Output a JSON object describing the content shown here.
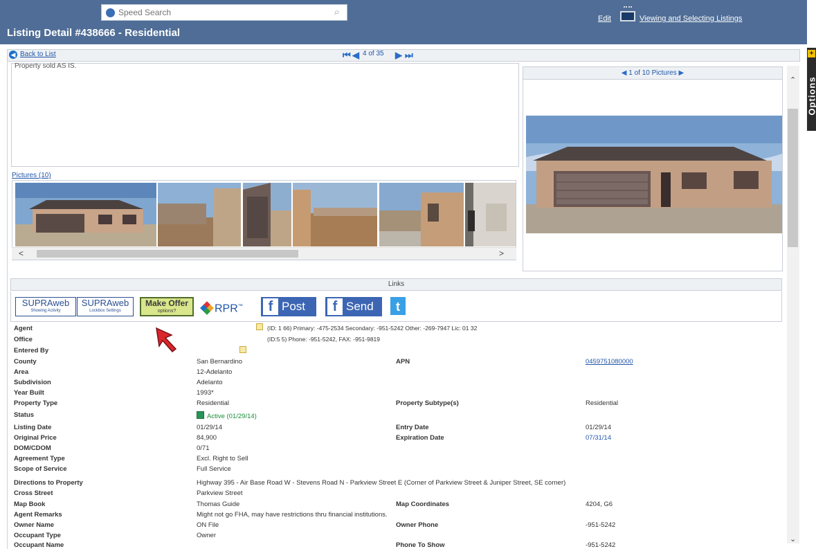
{
  "header": {
    "search_placeholder": "Speed Search",
    "title": "Listing Detail #438666 - Residential",
    "edit_label": "Edit",
    "viewing_label": "Viewing and Selecting Listings"
  },
  "nav": {
    "back_label": "Back to List",
    "pager": "4 of 35"
  },
  "options_label": "Options",
  "remarks_text": "Property sold AS IS.",
  "pictures_label": "Pictures (10)",
  "gallery_label": "1 of 10 Pictures",
  "links": {
    "title": "Links",
    "supra1": {
      "main": "SUPRAweb",
      "sub": "Showing Activity"
    },
    "supra2": {
      "main": "SUPRAweb",
      "sub": "Lockbox Settings"
    },
    "make_offer": {
      "main": "Make Offer",
      "sub": "options?"
    },
    "rpr": "RPR",
    "post": "Post",
    "send": "Send",
    "twitter": "t"
  },
  "details": [
    {
      "label": "Agent",
      "value": "(ID: 1   66) Primary:   -475-2534 Secondary:   -951-5242 Other:   -269-7947 Lic: 01   32"
    },
    {
      "label": "Office",
      "value": "(ID:5   5) Phone:   -951-5242, FAX:   -951-9819"
    },
    {
      "label": "Entered By",
      "value": ""
    },
    {
      "label": "County",
      "value": "San Bernardino",
      "label2": "APN",
      "value2": "0459751080000"
    },
    {
      "label": "Area",
      "value": "12-Adelanto"
    },
    {
      "label": "Subdivision",
      "value": "Adelanto"
    },
    {
      "label": "Year Built",
      "value": "1993*"
    },
    {
      "label": "Property Type",
      "value": "Residential",
      "label2": "Property Subtype(s)",
      "value2": "Residential"
    },
    {
      "label": "Status",
      "value": "Active",
      "value_date": "(01/29/14)"
    },
    {
      "label": "Listing Date",
      "value": "01/29/14",
      "label2": "Entry Date",
      "value2": "01/29/14"
    },
    {
      "label": "Original Price",
      "value": "84,900",
      "label2": "Expiration Date",
      "value2": "07/31/14"
    },
    {
      "label": "DOM/CDOM",
      "value": "0/71"
    },
    {
      "label": "Agreement Type",
      "value": "Excl. Right to Sell"
    },
    {
      "label": "Scope of Service",
      "value": "Full Service"
    },
    {
      "label": "Directions to Property",
      "value": "Highway 395 - Air Base Road W - Stevens Road N - Parkview Street E (Corner of Parkview Street & Juniper Street, SE corner)"
    },
    {
      "label": "Cross Street",
      "value": "Parkview Street"
    },
    {
      "label": "Map Book",
      "value": "Thomas Guide",
      "label2": "Map Coordinates",
      "value2": "4204, G6"
    },
    {
      "label": "Agent Remarks",
      "value": "Might not go FHA, may have restrictions thru financial institutions."
    },
    {
      "label": "Owner Name",
      "value": "ON File",
      "label2": "Owner Phone",
      "value2": "-951-5242"
    },
    {
      "label": "Occupant Type",
      "value": "Owner"
    },
    {
      "label": "Occupant Name",
      "value": "",
      "label2": "Phone To Show",
      "value2": "-951-5242"
    }
  ]
}
